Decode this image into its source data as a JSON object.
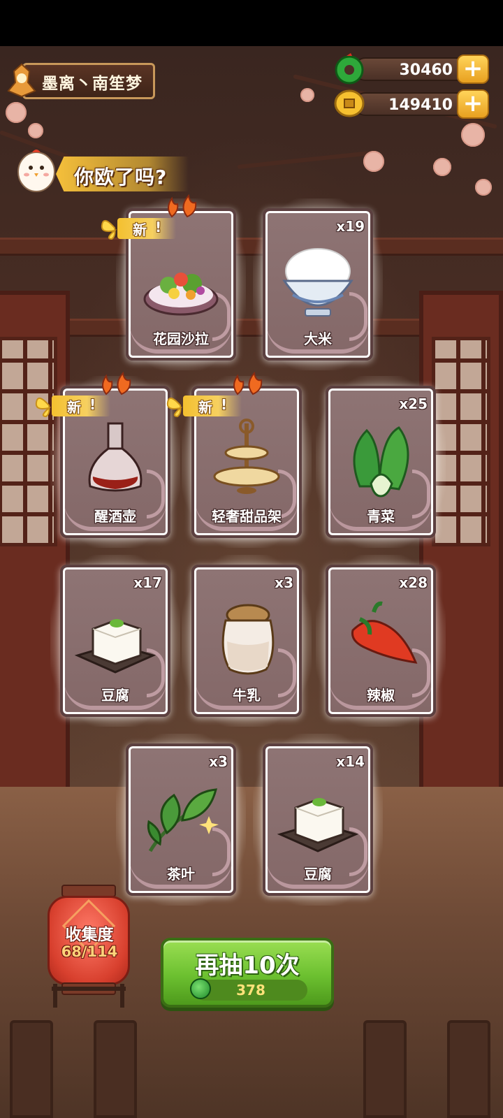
{
  "player": {
    "name": "墨离丶南笙梦"
  },
  "currency": {
    "jade": {
      "value": "30460",
      "icon": "jade-icon"
    },
    "coin": {
      "value": "149410",
      "icon": "coin-icon"
    }
  },
  "banner": {
    "text": "你欧了吗?"
  },
  "new_label": "新",
  "cards": [
    {
      "name": "花园沙拉",
      "count": "",
      "is_new": true,
      "icon": "salad-icon"
    },
    {
      "name": "大米",
      "count": "x19",
      "is_new": false,
      "icon": "rice-bowl-icon"
    },
    {
      "name": "醒酒壶",
      "count": "",
      "is_new": true,
      "icon": "decanter-icon"
    },
    {
      "name": "轻奢甜品架",
      "count": "",
      "is_new": true,
      "icon": "dessert-stand-icon"
    },
    {
      "name": "青菜",
      "count": "x25",
      "is_new": false,
      "icon": "bok-choy-icon"
    },
    {
      "name": "豆腐",
      "count": "x17",
      "is_new": false,
      "icon": "tofu-icon"
    },
    {
      "name": "牛乳",
      "count": "x3",
      "is_new": false,
      "icon": "milk-jar-icon"
    },
    {
      "name": "辣椒",
      "count": "x28",
      "is_new": false,
      "icon": "chili-icon"
    },
    {
      "name": "茶叶",
      "count": "x3",
      "is_new": false,
      "icon": "tea-leaf-icon"
    },
    {
      "name": "豆腐",
      "count": "x14",
      "is_new": false,
      "icon": "tofu-icon"
    }
  ],
  "collection": {
    "label": "收集度",
    "progress": "68/114"
  },
  "draw_again": {
    "label": "再抽10次",
    "cost": "378"
  },
  "colors": {
    "button_green": "#6cc030",
    "card_bg": "#8e7474",
    "gold": "#f4c030"
  }
}
